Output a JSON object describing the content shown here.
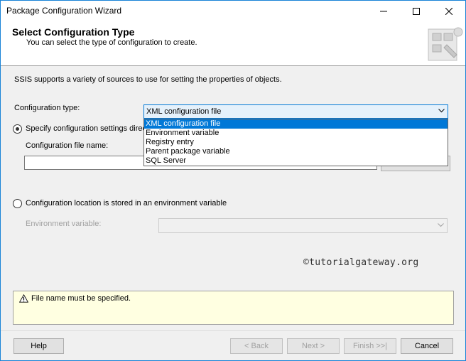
{
  "window": {
    "title": "Package Configuration Wizard"
  },
  "header": {
    "title": "Select Configuration Type",
    "subtitle": "You can select the type of configuration to create."
  },
  "body": {
    "description": "SSIS supports a variety of sources to use for setting the properties of objects.",
    "config_type_label": "Configuration type:",
    "config_type_selected": "XML configuration file",
    "config_type_options": [
      "XML configuration file",
      "Environment variable",
      "Registry entry",
      "Parent package variable",
      "SQL Server"
    ],
    "radio_specify_label": "Specify configuration settings directly",
    "file_name_label": "Configuration file name:",
    "file_name_value": "",
    "radio_env_label": "Configuration location is stored in an environment variable",
    "env_var_label": "Environment variable:",
    "env_var_value": "",
    "watermark": "©tutorialgateway.org"
  },
  "message": {
    "text": "File name must be specified."
  },
  "buttons": {
    "help": "Help",
    "back": "< Back",
    "next": "Next >",
    "finish": "Finish >>|",
    "cancel": "Cancel"
  },
  "colors": {
    "accent": "#0078d7",
    "message_bg": "#ffffe1"
  }
}
